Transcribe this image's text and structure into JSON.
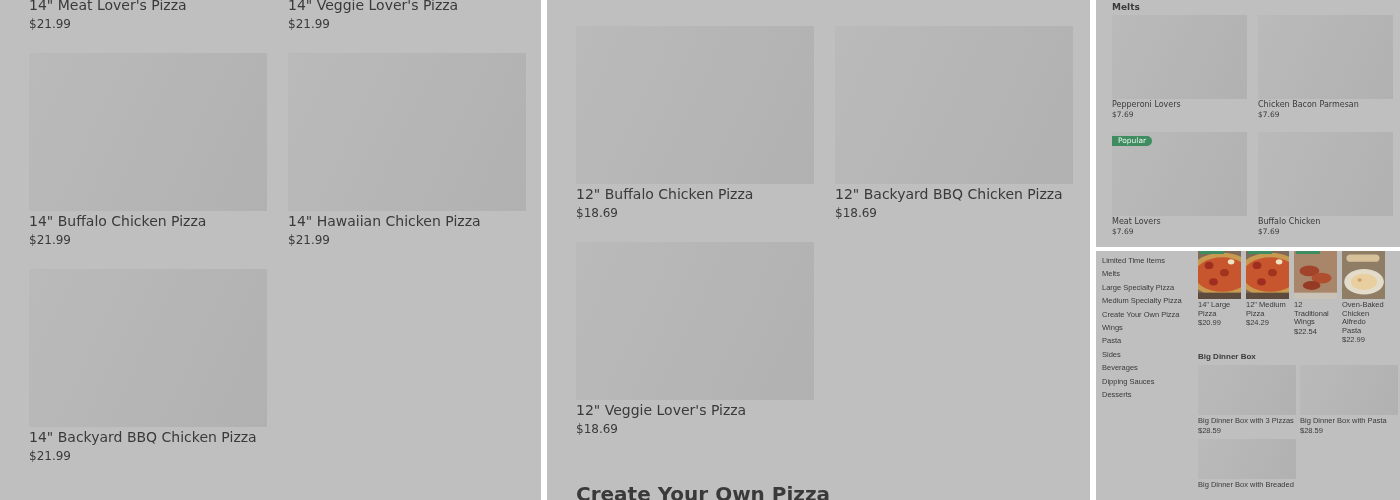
{
  "panel_1": {
    "partial_row": [
      {
        "title": "14\" Meat Lover's Pizza",
        "price": "$21.99"
      },
      {
        "title": "14\" Veggie Lover's Pizza",
        "price": "$21.99"
      }
    ],
    "items": [
      {
        "title": "14\" Buffalo Chicken Pizza",
        "price": "$21.99"
      },
      {
        "title": "14\" Hawaiian Chicken Pizza",
        "price": "$21.99"
      },
      {
        "title": "14\" Backyard BBQ Chicken Pizza",
        "price": "$21.99"
      }
    ]
  },
  "panel_2": {
    "items": [
      {
        "title": "12\" Buffalo Chicken Pizza",
        "price": "$18.69"
      },
      {
        "title": "12\" Backyard BBQ Chicken Pizza",
        "price": "$18.69"
      },
      {
        "title": "12\" Veggie Lover's Pizza",
        "price": "$18.69"
      }
    ],
    "heading": "Create Your Own Pizza"
  },
  "panel_3": {
    "heading": "Melts",
    "items": [
      {
        "title": "Pepperoni Lovers",
        "price": "$7.69"
      },
      {
        "title": "Chicken Bacon Parmesan",
        "price": "$7.69"
      },
      {
        "title": "Meat Lovers",
        "price": "$7.69",
        "badge": "Popular"
      },
      {
        "title": "Buffalo Chicken",
        "price": "$7.69"
      }
    ]
  },
  "panel_4": {
    "sidebar": [
      {
        "label": "Limited Time Items"
      },
      {
        "label": "Melts"
      },
      {
        "label": "Large Specialty Pizza"
      },
      {
        "label": "Medium Specialty Pizza"
      },
      {
        "label": "Create Your Own Pizza"
      },
      {
        "label": "Wings"
      },
      {
        "label": "Pasta"
      },
      {
        "label": "Sides"
      },
      {
        "label": "Beverages"
      },
      {
        "label": "Dipping Sauces"
      },
      {
        "label": "Desserts"
      }
    ],
    "featured": [
      {
        "title": "14\" Large Pizza",
        "price": "$20.99",
        "tag": true
      },
      {
        "title": "12\" Medium Pizza",
        "price": "$24.29",
        "tag": true
      },
      {
        "title": "12 Traditional Wings",
        "price": "$22.54",
        "tag": true
      },
      {
        "title": "Oven-Baked Chicken Alfredo Pasta",
        "price": "$22.99"
      }
    ],
    "section": {
      "heading": "Big Dinner Box",
      "items": [
        {
          "title": "Big Dinner Box with 3 Pizzas",
          "price": "$28.59"
        },
        {
          "title": "Big Dinner Box with Pasta",
          "price": "$28.59"
        },
        {
          "title": "Big Dinner Box with Breaded"
        }
      ]
    }
  }
}
